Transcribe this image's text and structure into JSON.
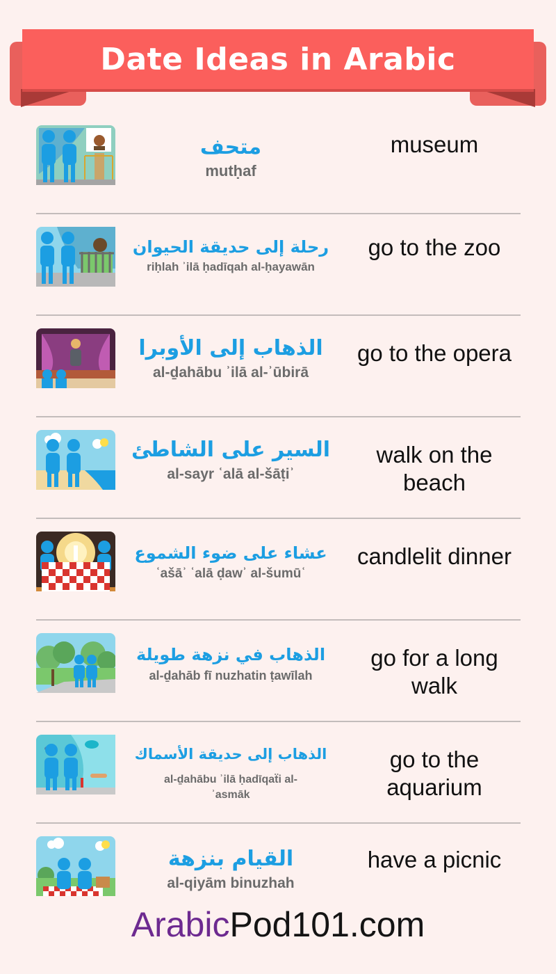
{
  "title": "Date Ideas in Arabic",
  "rows": [
    {
      "arabic": "متحف",
      "translit": "mutḥaf",
      "english": "museum",
      "icon": "museum-icon"
    },
    {
      "arabic": "رحلة إلى حديقة الحيوان",
      "translit": "riḥlah ʾilā ḥadīqah al-ḥayawān",
      "english": "go to the zoo",
      "icon": "zoo-icon"
    },
    {
      "arabic": "الذهاب إلى الأوبرا",
      "translit": "al-ḏahābu ʾilā al-ʾūbirā",
      "english": "go to the opera",
      "icon": "opera-icon"
    },
    {
      "arabic": "السير على الشاطئ",
      "translit": "al-sayr ʿalā al-šāṭiʾ",
      "english": "walk on the beach",
      "icon": "beach-icon"
    },
    {
      "arabic": "عشاء على ضوء الشموع",
      "translit": "ʿašāʾ ʿalā ḍawʾ al-šumūʿ",
      "english": "candlelit dinner",
      "icon": "candlelit-dinner-icon"
    },
    {
      "arabic": "الذهاب في نزهة طويلة",
      "translit": "al-ḏahāb fī nuzhatin ṭawīlah",
      "english": "go for a long walk",
      "icon": "park-walk-icon"
    },
    {
      "arabic": "الذهاب إلى حديقة الأسماك",
      "translit": "al-ḏahābu ʾilā ḥadīqaẗi al-ʾasmāk",
      "english": "go to the aquarium",
      "icon": "aquarium-icon"
    },
    {
      "arabic": "القيام بنزهة",
      "translit": "al-qiyām binuzhah",
      "english": "have a picnic",
      "icon": "picnic-icon"
    }
  ],
  "footer": {
    "part1": "Arabic",
    "part2": "Pod101.com"
  },
  "colors": {
    "banner": "#fb5f5c",
    "arabic_text": "#1c9ee2",
    "brand_purple": "#6d2a90",
    "people": "#1c9ee2"
  }
}
